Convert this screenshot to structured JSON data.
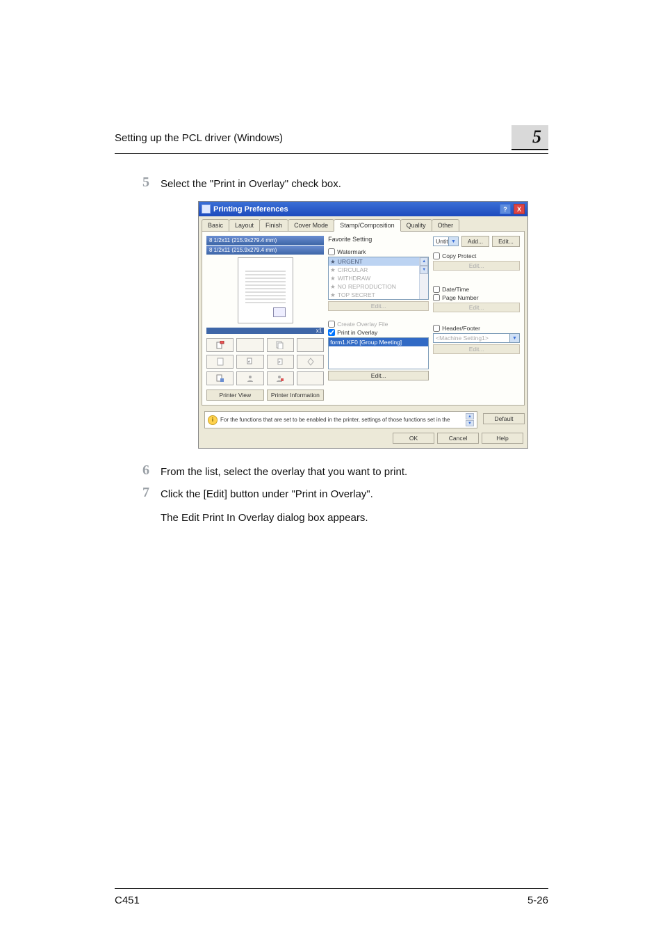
{
  "header": {
    "title": "Setting up the PCL driver (Windows)",
    "chapter": "5"
  },
  "steps": {
    "s5": {
      "num": "5",
      "text": "Select the \"Print in Overlay\" check box."
    },
    "s6": {
      "num": "6",
      "text": "From the list, select the overlay that you want to print."
    },
    "s7": {
      "num": "7",
      "text1": "Click the [Edit] button under \"Print in Overlay\".",
      "text2": "The Edit Print In Overlay dialog box appears."
    }
  },
  "dialog": {
    "title": "Printing Preferences",
    "tabs": {
      "basic": "Basic",
      "layout": "Layout",
      "finish": "Finish",
      "cover": "Cover Mode",
      "stamp": "Stamp/Composition",
      "quality": "Quality",
      "other": "Other"
    },
    "favorite": {
      "label": "Favorite Setting",
      "value": "Untitled",
      "add": "Add...",
      "edit": "Edit..."
    },
    "preview": {
      "size1": "8 1/2x11 (215.9x279.4 mm)",
      "size2": "8 1/2x11 (215.9x279.4 mm)",
      "x1": "x1",
      "printerView": "Printer View",
      "printerInfo": "Printer Information"
    },
    "watermark": {
      "label": "Watermark",
      "items": {
        "urgent": "URGENT",
        "circular": "CIRCULAR",
        "withdraw": "WITHDRAW",
        "norepro": "NO REPRODUCTION",
        "topsecret": "TOP SECRET"
      },
      "edit": "Edit..."
    },
    "overlay": {
      "createLabel": "Create Overlay File",
      "printLabel": "Print in Overlay",
      "item": "form1.KF0 [Group Meeting]",
      "edit": "Edit..."
    },
    "right": {
      "copyprotect": {
        "label": "Copy Protect",
        "edit": "Edit..."
      },
      "datetime": "Date/Time",
      "pagenumber": "Page Number",
      "dtEdit": "Edit...",
      "headerfooter": {
        "label": "Header/Footer",
        "combo": "<Machine Setting1>",
        "edit": "Edit..."
      }
    },
    "hint": "For the functions that are set to be enabled in the printer, settings of those functions set in the",
    "default": "Default",
    "ok": "OK",
    "cancel": "Cancel",
    "help": "Help"
  },
  "footer": {
    "model": "C451",
    "page": "5-26"
  }
}
